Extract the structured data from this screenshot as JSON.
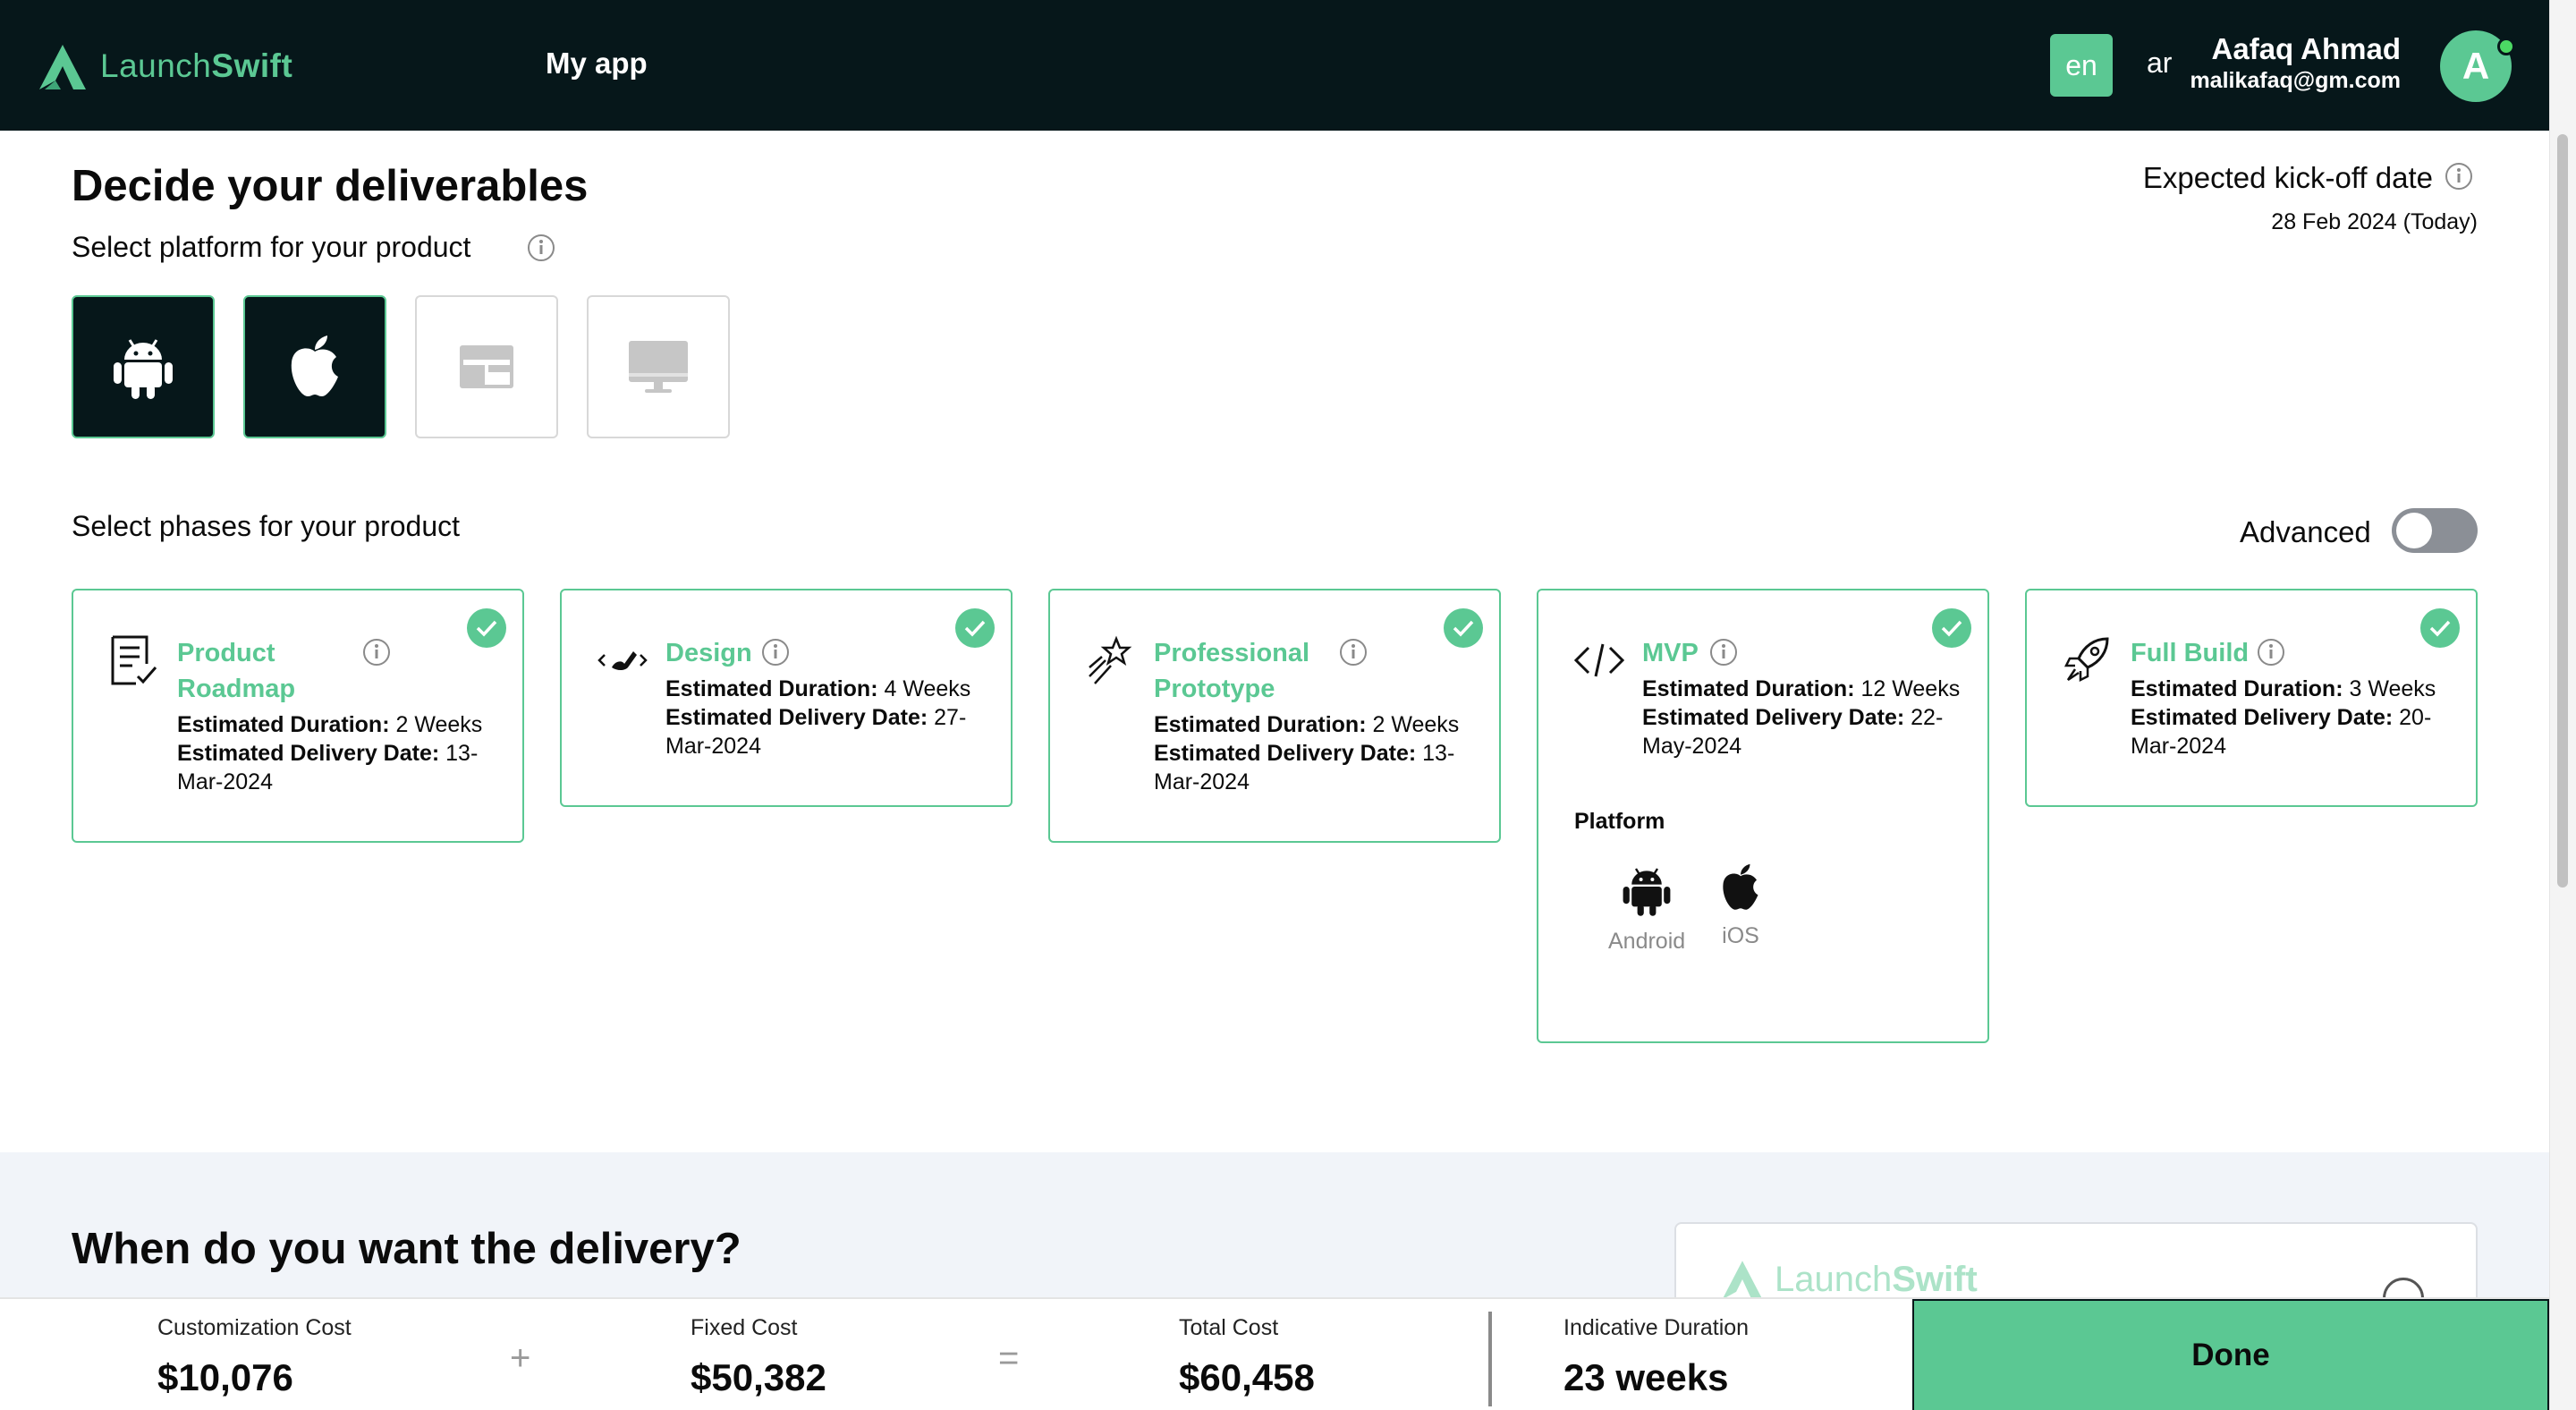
{
  "header": {
    "logo_text_light": "Launch",
    "logo_text_bold": "Swift",
    "app_name": "My app",
    "lang_en": "en",
    "lang_ar": "ar",
    "user_name": "Aafaq Ahmad",
    "user_email": "malikafaq@gm.com",
    "avatar_initial": "A"
  },
  "main": {
    "title": "Decide your deliverables",
    "platform_label": "Select platform for your product",
    "kickoff_label": "Expected kick-off date",
    "kickoff_date": "28 Feb 2024 (Today)",
    "platforms": [
      {
        "name": "android",
        "selected": true
      },
      {
        "name": "ios",
        "selected": true
      },
      {
        "name": "web",
        "selected": false
      },
      {
        "name": "desktop",
        "selected": false
      }
    ],
    "phases_label": "Select phases for your product",
    "advanced_label": "Advanced",
    "advanced_on": false
  },
  "phases": [
    {
      "name": "Product Roadmap",
      "duration_label": "Estimated Duration:",
      "duration": "2 Weeks",
      "delivery_label": "Estimated Delivery Date:",
      "delivery": "13-Mar-2024",
      "selected": true
    },
    {
      "name": "Design",
      "duration_label": "Estimated Duration:",
      "duration": "4 Weeks",
      "delivery_label": "Estimated Delivery Date:",
      "delivery": "27-Mar-2024",
      "selected": true
    },
    {
      "name": "Professional Prototype",
      "duration_label": "Estimated Duration:",
      "duration": "2 Weeks",
      "delivery_label": "Estimated Delivery Date:",
      "delivery": "13-Mar-2024",
      "selected": true
    },
    {
      "name": "MVP",
      "duration_label": "Estimated Duration:",
      "duration": "12 Weeks",
      "delivery_label": "Estimated Delivery Date:",
      "delivery": "22-May-2024",
      "selected": true,
      "platform_title": "Platform",
      "platform_android": "Android",
      "platform_ios": "iOS"
    },
    {
      "name": "Full Build",
      "duration_label": "Estimated Duration:",
      "duration": "3 Weeks",
      "delivery_label": "Estimated Delivery Date:",
      "delivery": "20-Mar-2024",
      "selected": true
    }
  ],
  "delivery": {
    "title": "When do you want the delivery?",
    "preview_logo_light": "Launch",
    "preview_logo_bold": "Swift"
  },
  "footer": {
    "customization_label": "Customization Cost",
    "customization_value": "$10,076",
    "plus": "+",
    "fixed_label": "Fixed Cost",
    "fixed_value": "$50,382",
    "equals": "=",
    "total_label": "Total Cost",
    "total_value": "$60,458",
    "duration_label": "Indicative Duration",
    "duration_value": "23 weeks",
    "done_label": "Done"
  },
  "colors": {
    "accent": "#5bc893",
    "dark": "#06171a",
    "toggle_off": "#8b8f96"
  }
}
